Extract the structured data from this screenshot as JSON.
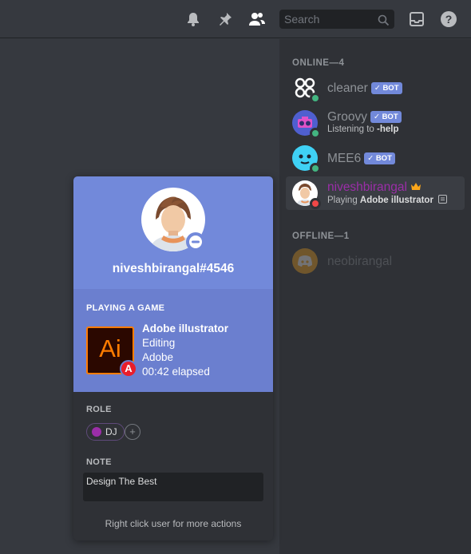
{
  "topbar": {
    "search_placeholder": "Search",
    "icons": [
      "bell-icon",
      "pin-icon",
      "members-icon",
      "search-icon",
      "inbox-icon",
      "help-icon"
    ]
  },
  "members": {
    "online_header": "ONLINE—4",
    "offline_header": "OFFLINE—1",
    "bot_label": "✓ BOT",
    "online": [
      {
        "name": "cleaner",
        "bot": true,
        "sub": "",
        "status": "online"
      },
      {
        "name": "Groovy",
        "bot": true,
        "sub_prefix": "Listening to ",
        "sub_bold": "-help",
        "status": "online"
      },
      {
        "name": "MEE6",
        "bot": true,
        "sub": "",
        "status": "online"
      },
      {
        "name": "niveshbirangal",
        "bot": false,
        "sub_prefix": "Playing ",
        "sub_bold": "Adobe illustrator",
        "status": "dnd",
        "owner": true,
        "name_color": "#9b2ea8"
      }
    ],
    "offline": [
      {
        "name": "neobirangal",
        "status": "offline"
      }
    ]
  },
  "popout": {
    "username": "niveshbirangal#4546",
    "activity_header": "PLAYING A GAME",
    "game": {
      "icon_text": "Ai",
      "small_icon_text": "A",
      "name": "Adobe illustrator",
      "details": "Editing",
      "state": "Adobe",
      "elapsed": "00:42 elapsed"
    },
    "role_header": "ROLE",
    "role": {
      "name": "DJ",
      "color": "#9b2ea8"
    },
    "add_role": "+",
    "note_header": "NOTE",
    "note": "Design The Best",
    "footer_hint": "Right click user for more actions"
  },
  "colors": {
    "blurple": "#7289da",
    "online": "#43b581",
    "dnd": "#f04747",
    "background": "#36393f",
    "sidebar": "#2f3136"
  }
}
